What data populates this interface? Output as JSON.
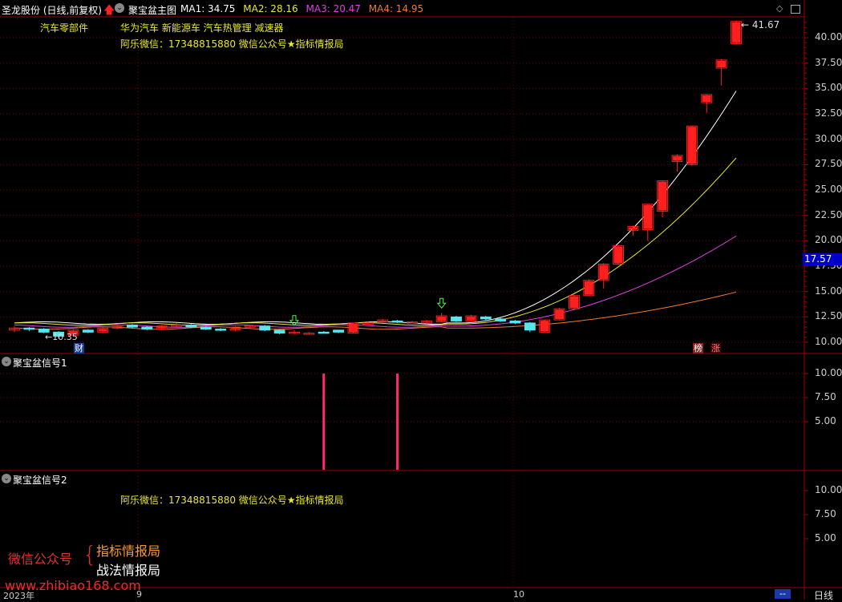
{
  "header": {
    "stock_title": "圣龙股份 (日线,前复权)",
    "main_chart_name": "聚宝盆主图",
    "ma_items": [
      {
        "label": "MA1: 34.75",
        "color": "#ffffff"
      },
      {
        "label": "MA2: 28.16",
        "color": "#e8e830"
      },
      {
        "label": "MA3: 20.47",
        "color": "#e040e0"
      },
      {
        "label": "MA4: 14.95",
        "color": "#f07a30"
      }
    ]
  },
  "tags": {
    "industry": "汽车零部件",
    "concepts": "华为汽车 新能源车 汽车热管理 减速器",
    "contact": "阿乐微信：17348815880    微信公众号★指标情报局"
  },
  "main_panel": {
    "yticks": [
      "40.00",
      "37.50",
      "35.00",
      "32.50",
      "30.00",
      "27.50",
      "25.00",
      "22.50",
      "20.00",
      "17.50",
      "15.00",
      "12.50",
      "10.00"
    ],
    "current_price": "17.57",
    "high_label": "41.67",
    "low_label": "10.35",
    "marker_cai": "财",
    "marker_bang": "榜",
    "marker_zhang": "涨"
  },
  "signal1": {
    "title": "聚宝盆信号1",
    "yticks": [
      "10.00",
      "7.50",
      "5.00"
    ]
  },
  "signal2": {
    "title": "聚宝盆信号2",
    "yticks": [
      "10.00",
      "7.50",
      "5.00"
    ],
    "contact": "阿乐微信：17348815880    微信公众号★指标情报局"
  },
  "watermark": {
    "left": "微信公众号",
    "right_1": "指标情报局",
    "right_2": "战法情报局",
    "url": "www.zhibiao168.com"
  },
  "xaxis": {
    "labels": [
      "2023年",
      "9",
      "10"
    ],
    "period": "日线",
    "scroll_indicator": "--"
  },
  "colors": {
    "up": "#ff1f1f",
    "down": "#55e6f0",
    "grid": "#7a0000",
    "signal": "#ff2a6a",
    "ma1": "#ffffff",
    "ma2": "#e8e830",
    "ma3": "#e040e0",
    "ma4": "#f07a30"
  },
  "chart_data": {
    "type": "candlestick",
    "price_range": [
      10.0,
      42.0
    ],
    "candles": [
      {
        "o": 11.2,
        "c": 11.4,
        "h": 11.6,
        "l": 11.0
      },
      {
        "o": 11.4,
        "c": 11.3,
        "h": 11.5,
        "l": 11.1
      },
      {
        "o": 11.3,
        "c": 11.0,
        "h": 11.4,
        "l": 10.9
      },
      {
        "o": 11.0,
        "c": 10.6,
        "h": 11.1,
        "l": 10.35
      },
      {
        "o": 10.7,
        "c": 11.2,
        "h": 11.3,
        "l": 10.6
      },
      {
        "o": 11.2,
        "c": 11.0,
        "h": 11.3,
        "l": 10.9
      },
      {
        "o": 11.0,
        "c": 11.4,
        "h": 11.5,
        "l": 10.9
      },
      {
        "o": 11.4,
        "c": 11.7,
        "h": 11.8,
        "l": 11.3
      },
      {
        "o": 11.7,
        "c": 11.5,
        "h": 11.8,
        "l": 11.4
      },
      {
        "o": 11.5,
        "c": 11.3,
        "h": 11.6,
        "l": 11.2
      },
      {
        "o": 11.3,
        "c": 11.6,
        "h": 11.7,
        "l": 11.2
      },
      {
        "o": 11.6,
        "c": 11.7,
        "h": 11.9,
        "l": 11.5
      },
      {
        "o": 11.7,
        "c": 11.5,
        "h": 11.8,
        "l": 11.4
      },
      {
        "o": 11.5,
        "c": 11.3,
        "h": 11.6,
        "l": 11.2
      },
      {
        "o": 11.3,
        "c": 11.2,
        "h": 11.4,
        "l": 11.1
      },
      {
        "o": 11.2,
        "c": 11.5,
        "h": 11.6,
        "l": 11.1
      },
      {
        "o": 11.5,
        "c": 11.6,
        "h": 11.7,
        "l": 11.4
      },
      {
        "o": 11.6,
        "c": 11.2,
        "h": 11.7,
        "l": 11.1
      },
      {
        "o": 11.2,
        "c": 10.9,
        "h": 11.3,
        "l": 10.8
      },
      {
        "o": 10.9,
        "c": 11.0,
        "h": 11.2,
        "l": 10.8
      },
      {
        "o": 10.9,
        "c": 10.9,
        "h": 11.0,
        "l": 10.8
      },
      {
        "o": 11.0,
        "c": 10.95,
        "h": 11.1,
        "l": 10.9
      },
      {
        "o": 11.2,
        "c": 11.0,
        "h": 11.2,
        "l": 10.9
      },
      {
        "o": 10.9,
        "c": 11.9,
        "h": 11.9,
        "l": 10.9
      },
      {
        "o": 11.9,
        "c": 11.9,
        "h": 12.0,
        "l": 11.8
      },
      {
        "o": 12.0,
        "c": 12.2,
        "h": 12.3,
        "l": 11.9
      },
      {
        "o": 12.1,
        "c": 12.0,
        "h": 12.2,
        "l": 11.9
      },
      {
        "o": 12.0,
        "c": 12.0,
        "h": 12.1,
        "l": 11.9
      },
      {
        "o": 11.9,
        "c": 12.1,
        "h": 12.2,
        "l": 11.8
      },
      {
        "o": 12.0,
        "c": 12.6,
        "h": 12.9,
        "l": 12.0
      },
      {
        "o": 12.5,
        "c": 12.1,
        "h": 12.6,
        "l": 12.0
      },
      {
        "o": 12.1,
        "c": 12.6,
        "h": 12.7,
        "l": 12.0
      },
      {
        "o": 12.5,
        "c": 12.3,
        "h": 12.6,
        "l": 12.2
      },
      {
        "o": 12.3,
        "c": 12.1,
        "h": 12.4,
        "l": 12.0
      },
      {
        "o": 12.1,
        "c": 11.9,
        "h": 12.2,
        "l": 11.8
      },
      {
        "o": 11.9,
        "c": 11.2,
        "h": 12.0,
        "l": 11.0
      },
      {
        "o": 11.0,
        "c": 12.2,
        "h": 12.2,
        "l": 11.0
      },
      {
        "o": 12.2,
        "c": 13.3,
        "h": 13.4,
        "l": 12.2
      },
      {
        "o": 13.3,
        "c": 14.6,
        "h": 14.7,
        "l": 13.3
      },
      {
        "o": 14.6,
        "c": 16.1,
        "h": 16.2,
        "l": 15.3
      },
      {
        "o": 16.1,
        "c": 17.7,
        "h": 17.8,
        "l": 15.3
      },
      {
        "o": 17.7,
        "c": 19.5,
        "h": 19.6,
        "l": 17.6
      },
      {
        "o": 21.0,
        "c": 21.4,
        "h": 21.5,
        "l": 20.5
      },
      {
        "o": 21.1,
        "c": 23.6,
        "h": 23.6,
        "l": 20.0
      },
      {
        "o": 22.9,
        "c": 25.9,
        "h": 25.9,
        "l": 22.3
      },
      {
        "o": 27.8,
        "c": 28.4,
        "h": 28.5,
        "l": 26.8
      },
      {
        "o": 27.5,
        "c": 31.3,
        "h": 31.3,
        "l": 27.4
      },
      {
        "o": 33.6,
        "c": 34.4,
        "h": 34.4,
        "l": 32.6
      },
      {
        "o": 37.0,
        "c": 37.8,
        "h": 37.9,
        "l": 35.3
      },
      {
        "o": 39.4,
        "c": 41.6,
        "h": 41.67,
        "l": 39.4
      }
    ],
    "ma_lines": [
      {
        "name": "MA1",
        "start": 11.9,
        "end": 34.75,
        "k": 0.14
      },
      {
        "name": "MA2",
        "start": 11.8,
        "end": 28.16,
        "k": 0.12
      },
      {
        "name": "MA3",
        "start": 11.6,
        "end": 20.47,
        "k": 0.11
      },
      {
        "name": "MA4",
        "start": 11.4,
        "end": 14.95,
        "k": 0.09
      }
    ],
    "signal1_bars": [
      {
        "index": 21,
        "value": 10.0
      },
      {
        "index": 26,
        "value": 10.0
      }
    ],
    "signal_range": [
      0,
      12
    ],
    "arrows": [
      {
        "index": 19
      },
      {
        "index": 29
      }
    ]
  }
}
